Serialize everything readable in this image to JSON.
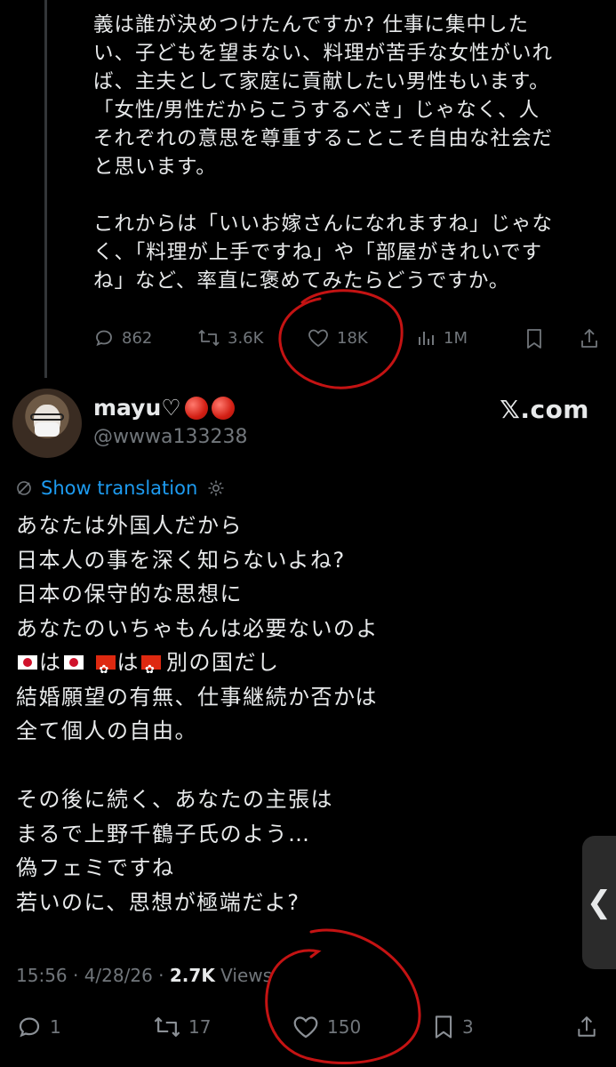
{
  "quoted_post": {
    "paragraphs": [
      "義は誰が決めつけたんですか? 仕事に集中した\nい、子どもを望まない、料理が苦手な女性がいれ\nば、主夫として家庭に貢献したい男性もいます。\n「女性/男性だからこうするべき」じゃなく、人\nそれぞれの意思を尊重することこそ自由な社会だ\nと思います。",
      "これからは「いいお嫁さんになれますね」じゃな\nく、「料理が上手ですね」や「部屋がきれいです\nね」など、率直に褒めてみたらどうですか。"
    ],
    "actions": {
      "reply_count": "862",
      "repost_count": "3.6K",
      "like_count": "18K",
      "views_count": "1M"
    }
  },
  "author": {
    "name": "mayu♡",
    "handle": "@wwwa133238"
  },
  "watermark": "𝕏.com",
  "translation": {
    "label": "Show translation"
  },
  "post": {
    "lines": [
      "あなたは外国人だから",
      "日本人の事を深く知らないよね?",
      "日本の保守的な思想に",
      "あなたのいちゃもんは必要ないのよ"
    ],
    "flag_line": {
      "particle_1": "は",
      "particle_2": "は",
      "tail": "別の国だし"
    },
    "lines_2": [
      "結婚願望の有無、仕事継続か否かは",
      "全て個人の自由。"
    ],
    "lines_3": [
      "その後に続く、あなたの主張は",
      "まるで上野千鶴子氏のよう…",
      "偽フェミですね",
      "若いのに、思想が極端だよ?"
    ],
    "time": "15:56 · 4/28/26 · ",
    "views_number": "2.7K",
    "views_label": " Views",
    "actions": {
      "reply_count": "1",
      "repost_count": "17",
      "like_count": "150",
      "bookmark_count": "3"
    }
  },
  "scroll_tab": {
    "glyph": "❮"
  },
  "colors": {
    "background": "#000000",
    "text": "#e7e9ea",
    "muted": "#71767b",
    "link": "#1d9bf0",
    "annotation": "#c41313"
  }
}
